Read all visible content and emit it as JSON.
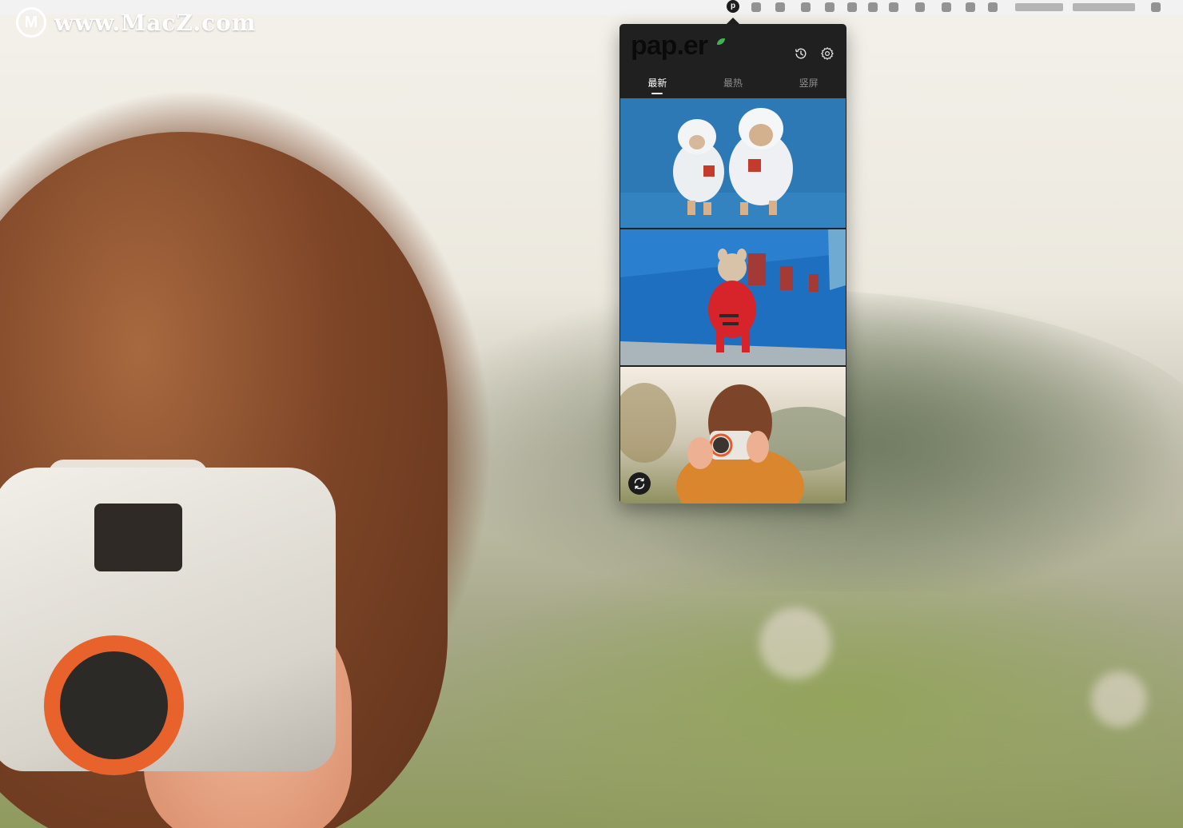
{
  "watermark": {
    "logo_letter": "M",
    "text": "www.MacZ.com"
  },
  "menubar": {
    "paper_status_letter": "p"
  },
  "popover": {
    "brand": "pap.er",
    "tabs": [
      {
        "label": "最新",
        "active": true
      },
      {
        "label": "最热",
        "active": false
      },
      {
        "label": "竖屏",
        "active": false
      }
    ],
    "wallpapers": [
      {
        "subject": "two dogs in white fluffy costumes on blue background"
      },
      {
        "subject": "french bulldog in red hoodie by blue wall"
      },
      {
        "subject": "girl with toy camera"
      }
    ],
    "icons": {
      "history": "history-icon",
      "settings": "gear-icon",
      "refresh": "refresh-icon"
    }
  },
  "colors": {
    "popover_bg": "#202020",
    "tab_active": "#ffffff",
    "tab_inactive": "#8d8d8d",
    "brand_leaf": "#3fb34f"
  }
}
